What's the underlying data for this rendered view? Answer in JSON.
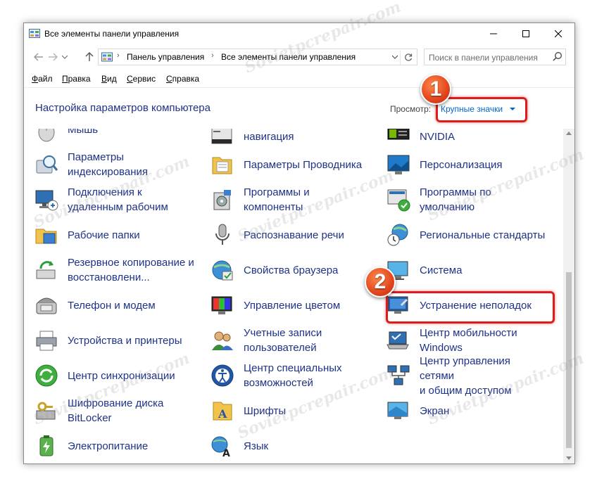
{
  "window": {
    "title": "Все элементы панели управления"
  },
  "address": {
    "path": [
      "Панель управления",
      "Все элементы панели управления"
    ],
    "search_placeholder": "Поиск в панели управления"
  },
  "menu": [
    {
      "hotkey": "Ф",
      "rest": "айл"
    },
    {
      "hotkey": "П",
      "rest": "равка"
    },
    {
      "hotkey": "В",
      "rest": "ид"
    },
    {
      "hotkey": "С",
      "rest": "ервис"
    },
    {
      "hotkey": "С",
      "rest": "правка"
    }
  ],
  "header": {
    "title": "Настройка параметров компьютера",
    "view_label": "Просмотр:",
    "view_value": "Крупные значки"
  },
  "callouts": [
    "1",
    "2"
  ],
  "items": {
    "col1": [
      {
        "l1": "Мышь",
        "l2": "",
        "icon": "mouse-icon"
      },
      {
        "l1": "Параметры",
        "l2": "индексирования",
        "icon": "indexing-icon"
      },
      {
        "l1": "Подключения к",
        "l2": "удаленным рабочим",
        "icon": "remote-desktop-icon"
      },
      {
        "l1": "Рабочие папки",
        "l2": "",
        "icon": "work-folders-icon"
      },
      {
        "l1": "Резервное копирование и",
        "l2": "восстановлени...",
        "icon": "backup-icon"
      },
      {
        "l1": "Телефон и модем",
        "l2": "",
        "icon": "phone-modem-icon"
      },
      {
        "l1": "Устройства и принтеры",
        "l2": "",
        "icon": "printer-icon"
      },
      {
        "l1": "Центр синхронизации",
        "l2": "",
        "icon": "sync-icon"
      },
      {
        "l1": "Шифрование диска",
        "l2": "BitLocker",
        "icon": "bitlocker-icon"
      },
      {
        "l1": "Электропитание",
        "l2": "",
        "icon": "power-icon"
      }
    ],
    "col2": [
      {
        "l1": "навигация",
        "l2": "",
        "icon": "taskbar-icon"
      },
      {
        "l1": "Параметры Проводника",
        "l2": "",
        "icon": "explorer-options-icon"
      },
      {
        "l1": "Программы и",
        "l2": "компоненты",
        "icon": "programs-icon"
      },
      {
        "l1": "Распознавание речи",
        "l2": "",
        "icon": "microphone-icon"
      },
      {
        "l1": "Свойства браузера",
        "l2": "",
        "icon": "internet-options-icon"
      },
      {
        "l1": "Управление цветом",
        "l2": "",
        "icon": "color-management-icon"
      },
      {
        "l1": "Учетные записи",
        "l2": "пользователей",
        "icon": "user-accounts-icon"
      },
      {
        "l1": "Центр специальных",
        "l2": "возможностей",
        "icon": "accessibility-icon"
      },
      {
        "l1": "Шрифты",
        "l2": "",
        "icon": "fonts-icon"
      },
      {
        "l1": "Язык",
        "l2": "",
        "icon": "language-icon"
      }
    ],
    "col3": [
      {
        "l1": "NVIDIA",
        "l2": "",
        "icon": "nvidia-icon"
      },
      {
        "l1": "Персонализация",
        "l2": "",
        "icon": "personalization-icon"
      },
      {
        "l1": "Программы по",
        "l2": "умолчанию",
        "icon": "default-programs-icon"
      },
      {
        "l1": "Региональные стандарты",
        "l2": "",
        "icon": "region-icon"
      },
      {
        "l1": "Система",
        "l2": "",
        "icon": "system-icon"
      },
      {
        "l1": "Устранение неполадок",
        "l2": "",
        "icon": "troubleshooting-icon"
      },
      {
        "l1": "Центр мобильности",
        "l2": "Windows",
        "icon": "mobility-center-icon"
      },
      {
        "l1": "Центр управления сетями",
        "l2": "и общим доступом",
        "icon": "network-center-icon"
      },
      {
        "l1": "Экран",
        "l2": "",
        "icon": "display-icon"
      }
    ]
  },
  "watermark": "Sovietpcrepair.com",
  "colors": {
    "link": "#1e3287",
    "highlight": "#e01b1b",
    "accent": "#0066cc"
  }
}
